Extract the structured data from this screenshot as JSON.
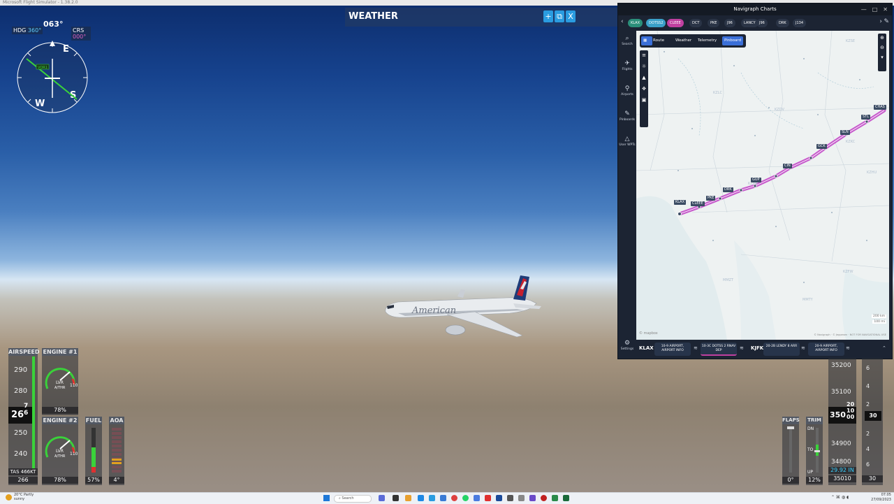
{
  "window_title": "Microsoft Flight Simulator - 1.38.2.0",
  "weather": {
    "title": "WEATHER",
    "add_label": "+",
    "external_label": "⧉",
    "close_label": "X"
  },
  "hud": {
    "heading": "063°",
    "hdg_label": "HDG",
    "hdg_value": "360°",
    "crs_label": "CRS",
    "crs_value": "000°",
    "vor_label": "VOR1",
    "compass_marks": [
      "E",
      "S",
      "W",
      "3",
      "6",
      "12",
      "15",
      "21",
      "24",
      "30",
      "33"
    ]
  },
  "airspeed": {
    "label": "AIRSPEED",
    "ticks": [
      "290",
      "280",
      "270",
      "260",
      "250",
      "240"
    ],
    "current_big": "26",
    "current_digits": "7\n6",
    "tas": "TAS 466KT",
    "bottom": "266"
  },
  "engine1": {
    "label": "ENGINE #1",
    "lvr": "LVR",
    "athr": "A/THR",
    "max": "110",
    "value": "78%"
  },
  "engine2": {
    "label": "ENGINE #2",
    "lvr": "LVR",
    "athr": "A/THR",
    "max": "110",
    "value": "78%"
  },
  "fuel": {
    "label": "FUEL",
    "value": "57%"
  },
  "aoa": {
    "label": "AOA",
    "value": "4°"
  },
  "flaps": {
    "label": "FLAPS",
    "value": "0°"
  },
  "trim": {
    "label": "TRIM",
    "dn": "DN",
    "to": "TO",
    "up": "UP",
    "value": "12%"
  },
  "altitude": {
    "ticks": [
      "35200",
      "35100",
      "34900",
      "34800"
    ],
    "current_big": "350",
    "current_digits": "20\n10\n00",
    "baro": "29.92 IN",
    "bottom": "35010"
  },
  "vspeed": {
    "ticks": [
      "6",
      "4",
      "2",
      "2",
      "4",
      "6"
    ],
    "current": "30",
    "bottom": "30"
  },
  "navigraph": {
    "title": "Navigraph Charts",
    "window_controls": [
      "—",
      "□",
      "✕"
    ],
    "route": [
      "KLAX",
      "DOTSS2",
      "CLEEE",
      "DCT",
      "PKE",
      "J96",
      "LANCY",
      "J96",
      "DRK",
      "J134"
    ],
    "sidebar": [
      {
        "icon": "⌕",
        "label": "Search"
      },
      {
        "icon": "✈",
        "label": "Flights"
      },
      {
        "icon": "⚲",
        "label": "Airports"
      },
      {
        "icon": "✎",
        "label": "Pinboards"
      },
      {
        "icon": "△",
        "label": "User WPTs"
      }
    ],
    "settings_label": "Settings",
    "map_tools": [
      "Route",
      "Weather",
      "Telemetry",
      "Pinboard"
    ],
    "map_labels": [
      "KZSE",
      "KZLC",
      "KZDV",
      "KZAB",
      "KZKC",
      "KZFW",
      "KZHU",
      "MMTY",
      "MMZT"
    ],
    "waypoints": [
      "KLAX",
      "CLEEE",
      "PKE",
      "DRK",
      "GUP",
      "CIN",
      "GCK",
      "SLN",
      "STL",
      "CHAS"
    ],
    "scale": [
      "200 km",
      "100 mi"
    ],
    "attribution": "© Navigraph · © Jeppesen · NOT FOR NAVIGATIONAL USE",
    "mapbox": "© mapbox",
    "bottom": {
      "dep": "KLAX",
      "arr": "KJFK",
      "charts": [
        "10-9 AIRPORT, AIRPORT INFO",
        "10-3C DOTSS 2 RNAV DEP",
        "20-2B LENDY 8 ARR",
        "20-9 AIRPORT, AIRPORT INFO"
      ]
    }
  },
  "taskbar": {
    "search": "Search",
    "time": "07:05",
    "date": "27/09/2023",
    "weather": "20°C Partly sunny"
  }
}
